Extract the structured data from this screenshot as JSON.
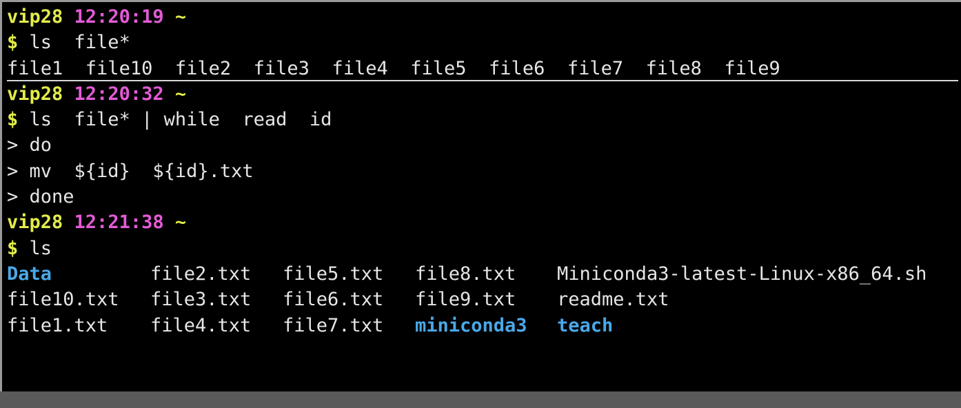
{
  "colors": {
    "background": "#000000",
    "prompt_user": "#e3ec4a",
    "prompt_time": "#e35bd6",
    "text": "#e6e6e6",
    "directory": "#4aa8e8"
  },
  "prompts": [
    {
      "user": "vip28",
      "time": "12:20:19",
      "dir": "~"
    },
    {
      "user": "vip28",
      "time": "12:20:32",
      "dir": "~"
    },
    {
      "user": "vip28",
      "time": "12:21:38",
      "dir": "~"
    }
  ],
  "commands": {
    "dollar": "$",
    "cmd1": " ls  file*",
    "cmd2": " ls  file* | while  read  id",
    "cont1": "> do",
    "cont2": "> mv  ${id}  ${id}.txt",
    "cont3": "> done",
    "cmd3": " ls"
  },
  "output1": [
    "file1",
    "file10",
    "file2",
    "file3",
    "file4",
    "file5",
    "file6",
    "file7",
    "file8",
    "file9"
  ],
  "output3": [
    [
      "Data",
      "file2.txt",
      "file5.txt",
      "file8.txt",
      "Miniconda3-latest-Linux-x86_64.sh"
    ],
    [
      "file10.txt",
      "file3.txt",
      "file6.txt",
      "file9.txt",
      "readme.txt"
    ],
    [
      "file1.txt",
      "file4.txt",
      "file7.txt",
      "miniconda3",
      "teach"
    ]
  ]
}
